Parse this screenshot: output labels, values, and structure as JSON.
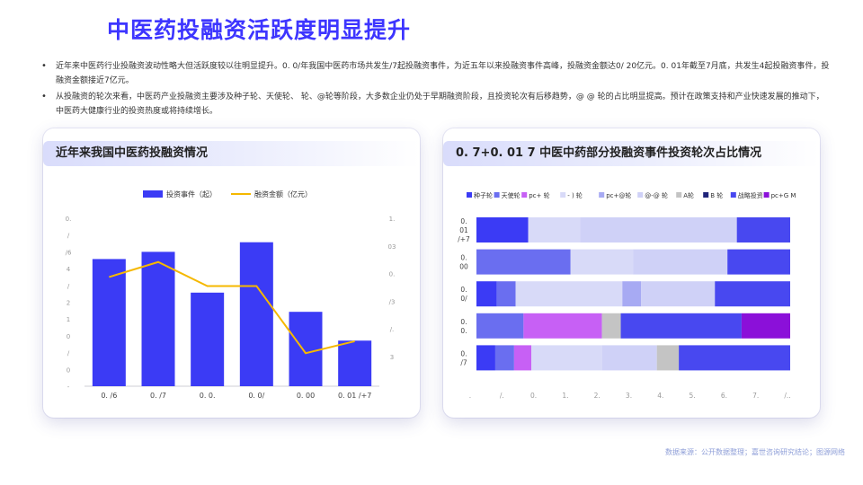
{
  "page": {
    "title": "中医药投融资活跃度明显提升"
  },
  "bullets": [
    "近年来中医药行业投融资波动性略大但活跃度较以往明显提升。0. 0/年我国中医药市场共发生/7起投融资事件，为近五年以来投融资事件高峰，投融资金额达0/ 20亿元。0. 01年截至7月底，共发生4起投融资事件，投融资金额接近7亿元。",
    "从投融资的轮次来看，中医药产业投融资主要涉及种子轮、天使轮、 轮、@轮等阶段，大多数企业仍处于早期融资阶段，且投资轮次有后移趋势，@ @ 轮的占比明显提高。预计在政策支持和产业快速发展的推动下，中医药大健康行业的投资热度或将持续增长。"
  ],
  "left_card": {
    "title": "近年来我国中医药投融资情况"
  },
  "right_card": {
    "title": "0.   7+0. 01 7 中医中药部分投融资事件投资轮次占比情况"
  },
  "footer": {
    "source": "数据来源：公开数据整理；嘉世咨询研究结论；图源网络"
  },
  "chart_data": [
    {
      "type": "bar",
      "legend": [
        "投资事件（起）",
        "融资金额（亿元）"
      ],
      "categories": [
        "0. /6",
        "0. /7",
        "0. 0.",
        "0. 0/",
        "0. 00",
        "0. 01 /+7"
      ],
      "series": [
        {
          "name": "投资事件（起）",
          "type": "bar",
          "color": "#3b3bf5",
          "values": [
            5.3,
            5.6,
            3.9,
            6.0,
            3.1,
            1.9
          ]
        },
        {
          "name": "融资金额（亿元）",
          "type": "line",
          "color": "#f5b800",
          "values": [
            1.32,
            1.57,
            1.17,
            1.17,
            0.05,
            0.25
          ]
        }
      ],
      "y_left_ticks": [
        "-",
        "0",
        "/",
        "0",
        "1",
        "2",
        "/",
        "4",
        "/6",
        "/",
        "0."
      ],
      "y_right_ticks": [
        "3",
        "/.",
        "/3",
        "0.",
        "03",
        "1."
      ],
      "ylim_left": [
        0,
        7
      ],
      "ylim_right": [
        -0.5,
        2.3
      ]
    },
    {
      "type": "bar",
      "orientation": "horizontal-stacked-100",
      "legend": [
        {
          "name": "种子轮",
          "color": "#3b3bf5"
        },
        {
          "name": "天使轮",
          "color": "#6a6ef0"
        },
        {
          "name": "pc+ 轮",
          "color": "#c760f5"
        },
        {
          "name": "- ) 轮",
          "color": "#d8daf8"
        },
        {
          "name": "pc+@轮",
          "color": "#a7aaf3"
        },
        {
          "name": "@-@ 轮",
          "color": "#cfd1f7"
        },
        {
          "name": "A轮",
          "color": "#c4c4c4"
        },
        {
          "name": "B 轮",
          "color": "#20247a"
        },
        {
          "name": "战略投资",
          "color": "#4848f0"
        },
        {
          "name": "pc+G M",
          "color": "#8b10d9"
        }
      ],
      "categories": [
        "0.\n01\n/+7",
        "0.\n00",
        "0.\n0/",
        "0.\n0.",
        "0.\n/7"
      ],
      "rows": [
        [
          {
            "s": "种子轮",
            "v": 16.5
          },
          {
            "s": "- ) 轮",
            "v": 16.5
          },
          {
            "s": "@-@ 轮",
            "v": 50
          },
          {
            "s": "战略投资",
            "v": 17
          }
        ],
        [
          {
            "s": "天使轮",
            "v": 30
          },
          {
            "s": "- ) 轮",
            "v": 20
          },
          {
            "s": "@-@ 轮",
            "v": 30
          },
          {
            "s": "战略投资",
            "v": 20
          }
        ],
        [
          {
            "s": "种子轮",
            "v": 6.5
          },
          {
            "s": "天使轮",
            "v": 6
          },
          {
            "s": "- ) 轮",
            "v": 34
          },
          {
            "s": "pc+@轮",
            "v": 6
          },
          {
            "s": "@-@ 轮",
            "v": 23.5
          },
          {
            "s": "战略投资",
            "v": 24
          }
        ],
        [
          {
            "s": "天使轮",
            "v": 15
          },
          {
            "s": "pc+ 轮",
            "v": 25
          },
          {
            "s": "A轮",
            "v": 6
          },
          {
            "s": "战略投资",
            "v": 38.5
          },
          {
            "s": "pc+G M",
            "v": 15.5
          }
        ],
        [
          {
            "s": "种子轮",
            "v": 6
          },
          {
            "s": "天使轮",
            "v": 6
          },
          {
            "s": "pc+ 轮",
            "v": 5.5
          },
          {
            "s": "- ) 轮",
            "v": 22.5
          },
          {
            "s": "@-@ 轮",
            "v": 17.5
          },
          {
            "s": "A轮",
            "v": 7
          },
          {
            "s": "战略投资",
            "v": 35.5
          }
        ]
      ],
      "x_ticks": [
        ".",
        "/.",
        "0.",
        "1.",
        "2.",
        "3.",
        "4.",
        "5.",
        "6.",
        "7.",
        "/.."
      ]
    }
  ]
}
